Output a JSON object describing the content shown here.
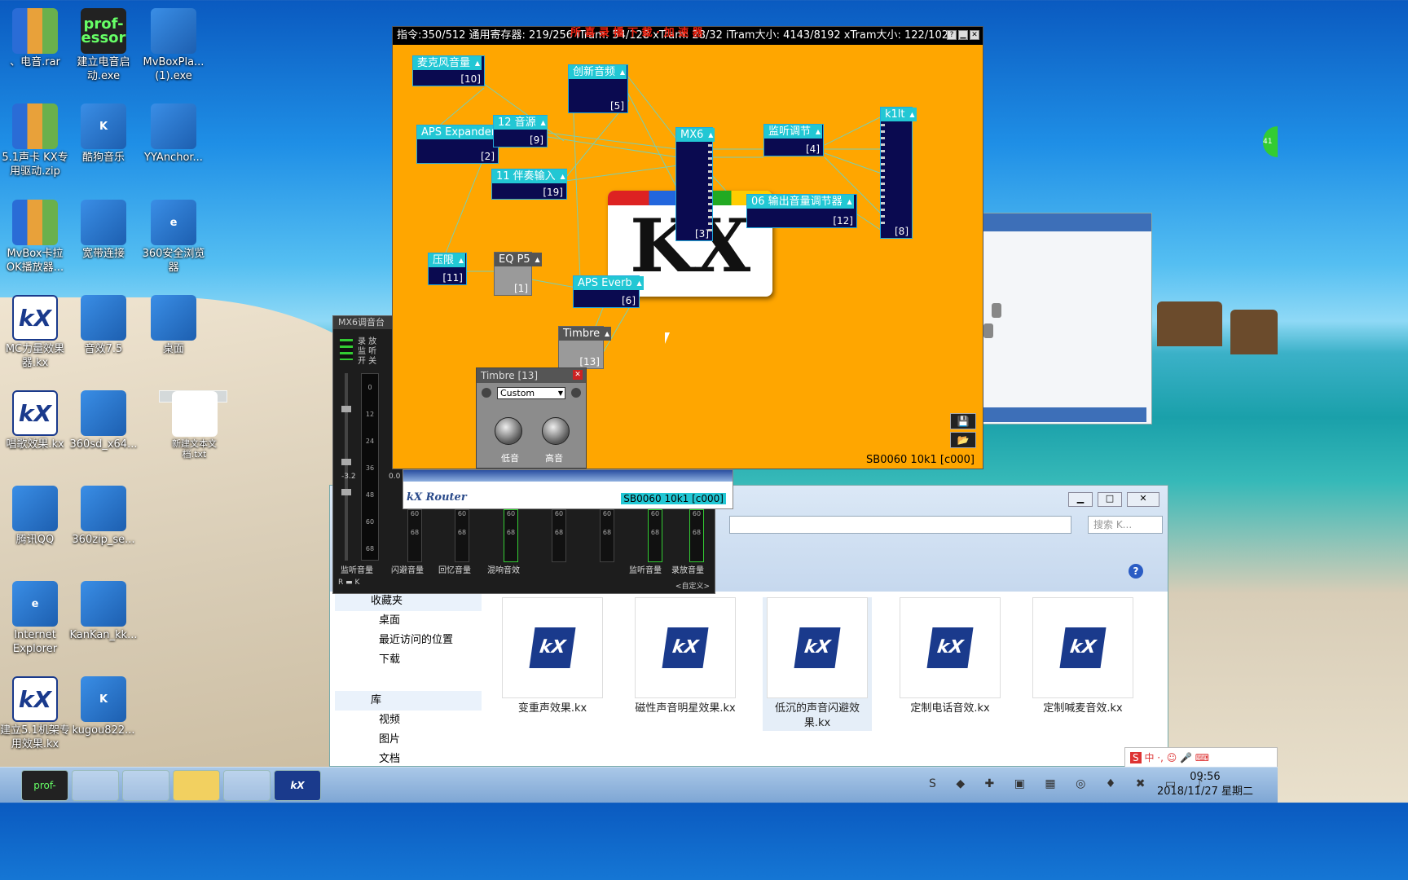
{
  "desktop": {
    "icons": [
      {
        "label": "、电音.rar",
        "type": "rar"
      },
      {
        "label": "建立电音启动.exe",
        "type": "prof",
        "ictext": "prof-essor"
      },
      {
        "label": "MvBoxPla...(1).exe",
        "type": "app"
      },
      {
        "label": "5.1声卡 KX专用驱动.zip",
        "type": "rar"
      },
      {
        "label": "酷狗音乐",
        "type": "app",
        "ictext": "K"
      },
      {
        "label": "YYAnchor...",
        "type": "app"
      },
      {
        "label": "MvBox卡拉OK播放器...",
        "type": "rar"
      },
      {
        "label": "宽带连接",
        "type": "app"
      },
      {
        "label": "360安全浏览器",
        "type": "app",
        "ictext": "e"
      },
      {
        "label": "MC力量效果器.kx",
        "type": "kx",
        "ictext": "kX"
      },
      {
        "label": "音效7.5",
        "type": "app"
      },
      {
        "label": "桌面",
        "type": "app"
      },
      {
        "label": "唱歌效果.kx",
        "type": "kx",
        "ictext": "kX"
      },
      {
        "label": "360sd_x64...",
        "type": "app"
      },
      {
        "label": "新建文本文档.txt",
        "type": "txt"
      },
      {
        "label": "腾讯QQ",
        "type": "app"
      },
      {
        "label": "360zip_se...",
        "type": "app"
      },
      {
        "label": "Internet Explorer",
        "type": "app",
        "ictext": "e"
      },
      {
        "label": "KanKan_kk...",
        "type": "app"
      },
      {
        "label": "建立5.1机架专用效果.kx",
        "type": "kx",
        "ictext": "kX"
      },
      {
        "label": "kugou822...",
        "type": "app",
        "ictext": "K"
      }
    ]
  },
  "kx_window": {
    "title": "指令:350/512 通用寄存器: 219/256 iTram: 54/128 xTram: 28/32 iTram大小: 4143/8192 xTram大小: 122/1024",
    "title_overlay": "所 喜 录 播 下 载 · 加 速 器",
    "logo": "KX",
    "status": "SB0060 10k1 [c000]",
    "modules": [
      {
        "name": "麦克风音量",
        "num": "[10]"
      },
      {
        "name": "创新音频",
        "num": "[5]"
      },
      {
        "name": "APS Expander",
        "num": "[2]"
      },
      {
        "name": "12 音源",
        "num": "[9]"
      },
      {
        "name": "11 伴奏输入",
        "num": "[19]"
      },
      {
        "name": "MX6",
        "num": "[3]"
      },
      {
        "name": "监听调节",
        "num": "[4]"
      },
      {
        "name": "k1lt",
        "num": "[8]"
      },
      {
        "name": "06 输出音量调节器",
        "num": "[12]"
      },
      {
        "name": "压限",
        "num": "[11]"
      },
      {
        "name": "EQ P5",
        "num": "[1]"
      },
      {
        "name": "APS Everb",
        "num": "[6]"
      },
      {
        "name": "Timbre",
        "num": "[13]"
      }
    ]
  },
  "timbre_popup": {
    "title": "Timbre [13]",
    "preset": "Custom",
    "knob_low": "低音",
    "knob_high": "高音"
  },
  "mx6_panel": {
    "title": "MX6调音台",
    "rows": [
      "录 放",
      "监 听",
      "开 关"
    ],
    "faders": [
      "60",
      "68",
      "60",
      "68",
      "60",
      "68",
      "60",
      "68",
      "60",
      "68",
      "60",
      "68",
      "60",
      "68",
      "60",
      "68"
    ],
    "labels": [
      "监听音量",
      "闪避音量",
      "回忆音量",
      "混响音效",
      "监听音量",
      "录放音量"
    ],
    "footer": "<自定义>",
    "values": [
      "0",
      "12",
      "24",
      "36",
      "48",
      "60",
      "68"
    ],
    "level": "-3.2",
    "level2": "0.0"
  },
  "router": {
    "title": "kX Router",
    "status": "SB0060 10k1 [c000]"
  },
  "explorer": {
    "search_placeholder": "搜索 K...",
    "sidebar": [
      "收藏夹",
      "桌面",
      "最近访问的位置",
      "下载",
      "库",
      "视频",
      "图片",
      "文档"
    ],
    "files": [
      "变重声效果.kx",
      "磁性声音明星效果.kx",
      "低沉的声音闪避效果.kx",
      "定制电话音效.kx",
      "定制喊麦音效.kx"
    ]
  },
  "taskbar": {
    "time": "09:56",
    "date": "2018/11/27 星期二",
    "ime": "中 ·, ☺ 🎤 ⌨"
  },
  "colors": {
    "kx_bg": "#ffa600",
    "module_header": "#22c7d4",
    "module_body": "#0a0a50"
  }
}
